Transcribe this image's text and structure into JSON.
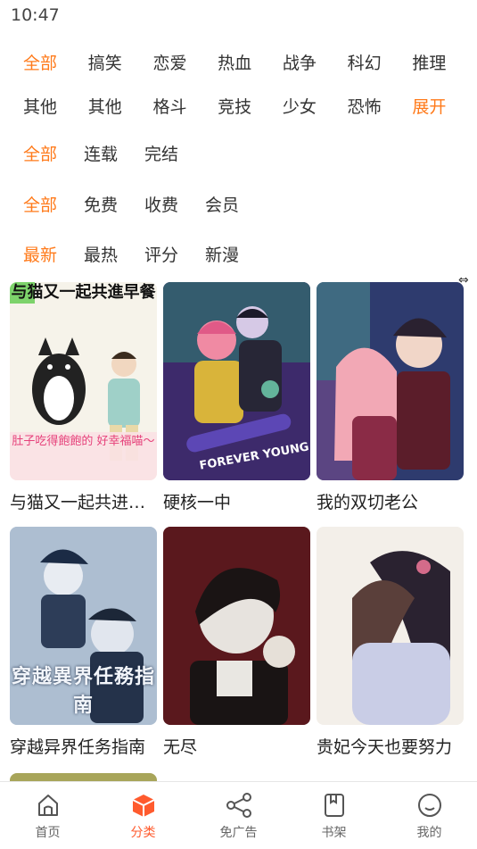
{
  "status": {
    "time": "10:47"
  },
  "filters": {
    "genre_row1": [
      {
        "label": "全部",
        "active": true
      },
      {
        "label": "搞笑"
      },
      {
        "label": "恋爱"
      },
      {
        "label": "热血"
      },
      {
        "label": "战争"
      },
      {
        "label": "科幻"
      },
      {
        "label": "推理"
      }
    ],
    "genre_row2": [
      {
        "label": "其他"
      },
      {
        "label": "其他"
      },
      {
        "label": "格斗"
      },
      {
        "label": "竞技"
      },
      {
        "label": "少女"
      },
      {
        "label": "恐怖"
      },
      {
        "label": "展开"
      }
    ],
    "status_row": [
      {
        "label": "全部",
        "active": true
      },
      {
        "label": "连载"
      },
      {
        "label": "完结"
      }
    ],
    "price_row": [
      {
        "label": "全部",
        "active": true
      },
      {
        "label": "免费"
      },
      {
        "label": "收费"
      },
      {
        "label": "会员"
      }
    ],
    "sort_row": [
      {
        "label": "最新",
        "active": true
      },
      {
        "label": "最热"
      },
      {
        "label": "评分"
      },
      {
        "label": "新漫"
      }
    ]
  },
  "comics": [
    {
      "title": "与猫又一起共进早餐",
      "cover_text_top": "与猫又一起共進早餐",
      "cover_text_bottom": "肚子吃得飽飽的 好幸福喵～"
    },
    {
      "title": "硬核一中",
      "cover_text_bottom": "FOREVER YOUNG"
    },
    {
      "title": "我的双切老公"
    },
    {
      "title": "穿越异界任务指南",
      "cover_text_bottom": "穿越異界任務指南"
    },
    {
      "title": "无尽"
    },
    {
      "title": "贵妃今天也要努力"
    }
  ],
  "tabbar": [
    {
      "label": "首页",
      "icon": "home-icon"
    },
    {
      "label": "分类",
      "icon": "category-cube-icon",
      "active": true
    },
    {
      "label": "免广告",
      "icon": "share-icon"
    },
    {
      "label": "书架",
      "icon": "bookshelf-icon"
    },
    {
      "label": "我的",
      "icon": "profile-smile-icon"
    }
  ],
  "colors": {
    "accent": "#ff7a1a",
    "tab_active": "#ff5b2e"
  }
}
